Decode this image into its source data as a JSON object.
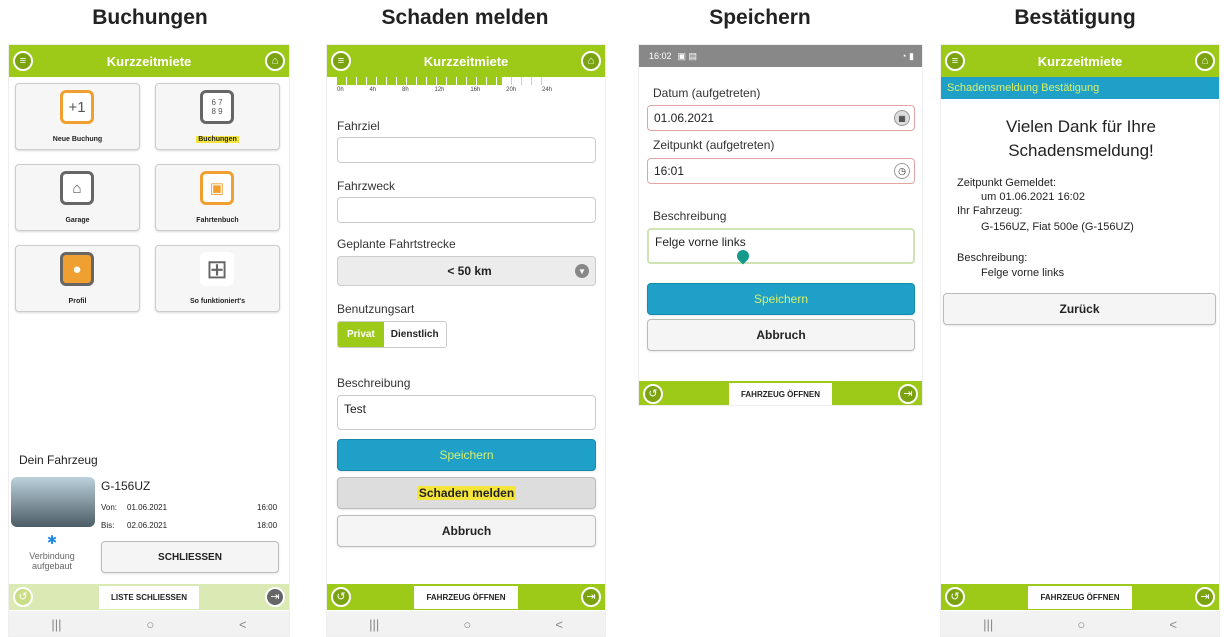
{
  "titles": [
    "Buchungen",
    "Schaden melden",
    "Speichern",
    "Bestätigung"
  ],
  "header": {
    "app_title": "Kurzzeitmiete",
    "menu_icon": "menu-icon",
    "home_icon": "home-icon"
  },
  "screen1": {
    "tiles": [
      {
        "label": "Neue Buchung",
        "icon": "+1"
      },
      {
        "label": "Buchungen",
        "icon": "6 7 / 8 9"
      },
      {
        "label": "Garage",
        "icon": "car"
      },
      {
        "label": "Fahrtenbuch",
        "icon": "car"
      },
      {
        "label": "Profil",
        "icon": "person"
      },
      {
        "label": "So funktioniert's",
        "icon": "grid"
      }
    ],
    "vehicle_heading": "Dein Fahrzeug",
    "plate": "G-156UZ",
    "von_label": "Von:",
    "von_date": "01.06.2021",
    "von_time": "16:00",
    "bis_label": "Bis:",
    "bis_date": "02.06.2021",
    "bis_time": "18:00",
    "bluetooth_status": "Verbindung aufgebaut",
    "close_button": "SCHLIESSEN",
    "list_close": "LISTE SCHLIESSEN"
  },
  "screen2": {
    "timeline_ticks": [
      "0h",
      "4h",
      "8h",
      "12h",
      "16h",
      "20h",
      "24h"
    ],
    "fahrziel_label": "Fahrziel",
    "fahrziel_value": "",
    "fahrzweck_label": "Fahrzweck",
    "fahrzweck_value": "",
    "strecke_label": "Geplante Fahrtstrecke",
    "strecke_value": "< 50 km",
    "usage_label": "Benutzungsart",
    "usage_private": "Privat",
    "usage_business": "Dienstlich",
    "desc_label": "Beschreibung",
    "desc_value": "Test",
    "save": "Speichern",
    "report": "Schaden melden",
    "cancel": "Abbruch",
    "open_vehicle": "FAHRZEUG ÖFFNEN"
  },
  "screen3": {
    "status_time": "16:02",
    "date_label": "Datum (aufgetreten)",
    "date_value": "01.06.2021",
    "time_label": "Zeitpunkt (aufgetreten)",
    "time_value": "16:01",
    "desc_label": "Beschreibung",
    "desc_value": "Felge vorne links",
    "save": "Speichern",
    "cancel": "Abbruch",
    "open_vehicle": "FAHRZEUG ÖFFNEN"
  },
  "screen4": {
    "subheader": "Schadensmeldung Bestätigung",
    "thanks": "Vielen Dank für Ihre Schadensmeldung!",
    "reported_label": "Zeitpunkt Gemeldet:",
    "reported_value": "um 01.06.2021 16:02",
    "vehicle_label": "Ihr Fahrzeug:",
    "vehicle_value": "G-156UZ, Fiat 500e (G-156UZ)",
    "desc_label": "Beschreibung:",
    "desc_value": "Felge vorne links",
    "back": "Zurück",
    "open_vehicle": "FAHRZEUG ÖFFNEN"
  },
  "nav": {
    "recent": "|||",
    "home": "○",
    "back": "<"
  }
}
